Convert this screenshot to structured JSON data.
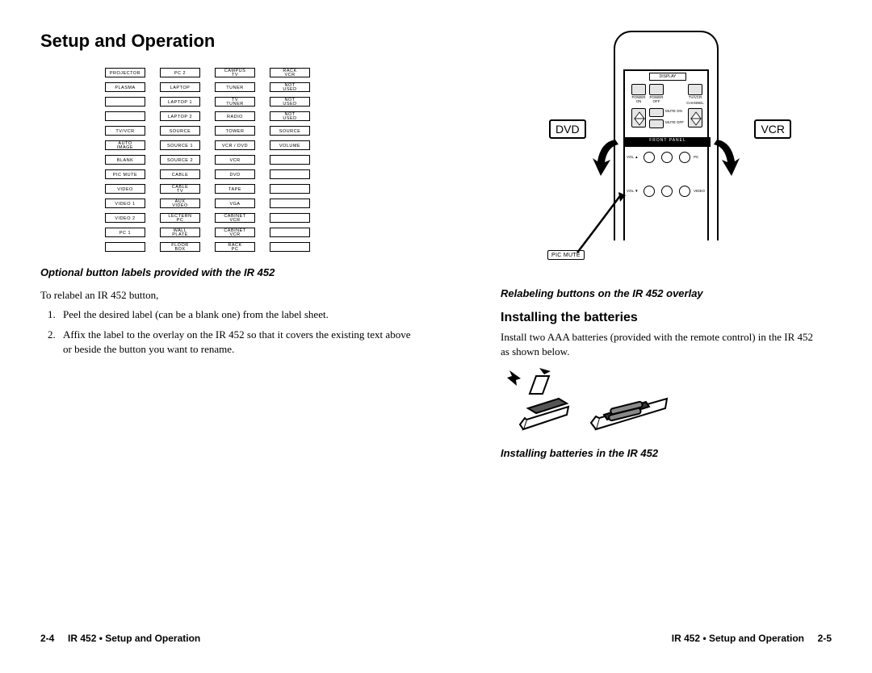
{
  "title": "Setup and Operation",
  "labels": [
    [
      "PROJECTOR",
      "PC 2",
      "CAMPUS\nTV",
      "RACK\nVCR"
    ],
    [
      "PLASMA",
      "LAPTOP",
      "TUNER",
      "NOT\nUSED"
    ],
    [
      "",
      "LAPTOP 1",
      "TV\nTUNER",
      "NOT\nUSED"
    ],
    [
      "",
      "LAPTOP 2",
      "RADIO",
      "NOT\nUSED"
    ],
    [
      "TV/VCR",
      "SOURCE",
      "TOWER",
      "SOURCE"
    ],
    [
      "AUTO\nIMAGE",
      "SOURCE 1",
      "VCR / DVD",
      "VOLUME"
    ],
    [
      "BLANK",
      "SOURCE 2",
      "VCR",
      ""
    ],
    [
      "PIC MUTE",
      "CABLE",
      "DVD",
      ""
    ],
    [
      "VIDEO",
      "CABLE\nTV",
      "TAPE",
      ""
    ],
    [
      "VIDEO 1",
      "AUX\nVIDEO",
      "VGA",
      ""
    ],
    [
      "VIDEO 2",
      "LECTERN\nPC",
      "CABINET\nVCR",
      ""
    ],
    [
      "PC 1",
      "WALL\nPLATE",
      "CABINET\nVCR",
      ""
    ],
    [
      "",
      "FLOOR\nBOX",
      "RACK\nPC",
      ""
    ]
  ],
  "caption_left": "Optional button labels provided with the IR 452",
  "relabel_intro": "To relabel an IR 452 button,",
  "steps": [
    "Peel the desired label (can be a blank one) from the label sheet.",
    "Affix the label to the overlay on the IR 452 so that it covers the existing text above or beside the button you want to rename."
  ],
  "remote": {
    "side_left": "DVD",
    "side_right": "VCR",
    "pic_mute": "PIC MUTE",
    "display": "DISPLAY",
    "power_on": "POWER\nON",
    "power_off": "POWER\nOFF",
    "tvvcr": "TV/VCR",
    "mute_on": "MUTE ON",
    "mute_off": "MUTE OFF",
    "channel": "CHANNEL",
    "front_panel": "FRONT PANEL",
    "vol_up": "VOL ▲",
    "vol_dn": "VOL ▼",
    "pc": "PC",
    "video": "VIDEO"
  },
  "caption_right1": "Relabeling buttons on the IR 452 overlay",
  "heading_batt": "Installing the batteries",
  "batt_text": "Install two AAA batteries (provided with the remote control) in the IR 452 as shown below.",
  "caption_right2": "Installing batteries in the IR 452",
  "footer_left_num": "2-4",
  "footer_text": "IR 452 • Setup and Operation",
  "footer_right_num": "2-5"
}
